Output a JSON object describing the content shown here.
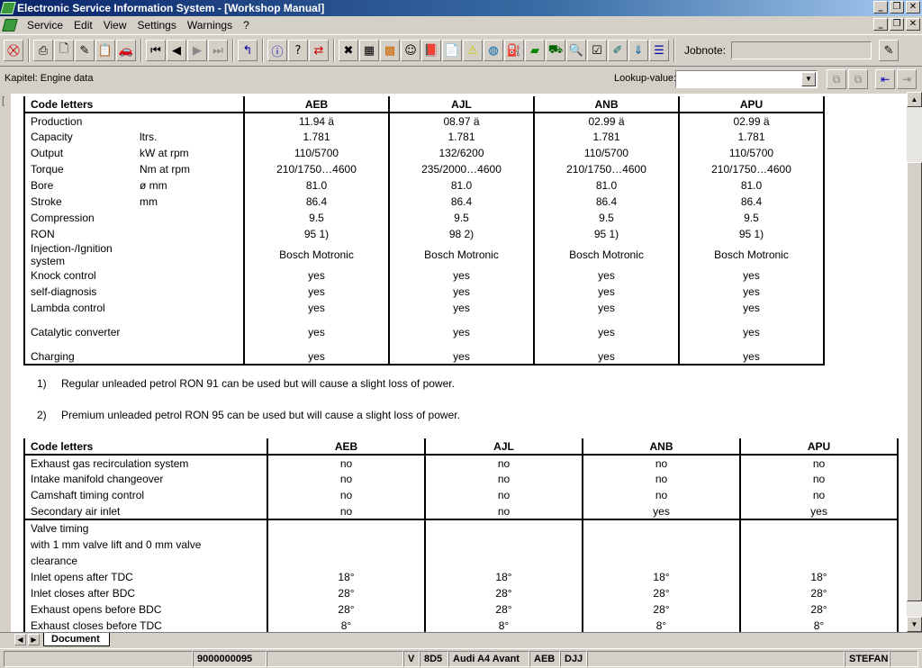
{
  "window": {
    "title": "Electronic Service Information System - [Workshop Manual]"
  },
  "menu": {
    "items": [
      "Service",
      "Edit",
      "View",
      "Settings",
      "Warnings",
      "?"
    ]
  },
  "toolbar": {
    "jobnote_label": "Jobnote:",
    "jobnote_value": ""
  },
  "chapterbar": {
    "chapter": "Kapitel: Engine data",
    "lookup_label": "Lookup-value:",
    "lookup_value": ""
  },
  "table1": {
    "headers": [
      "Code letters",
      "",
      "AEB",
      "AJL",
      "ANB",
      "APU"
    ],
    "rows": [
      [
        "Production",
        "",
        "11.94 ä",
        "08.97 ä",
        "02.99 ä",
        "02.99 ä"
      ],
      [
        "Capacity",
        "ltrs.",
        "1.781",
        "1.781",
        "1.781",
        "1.781"
      ],
      [
        "Output",
        "kW at rpm",
        "110/5700",
        "132/6200",
        "110/5700",
        "110/5700"
      ],
      [
        "Torque",
        "Nm at rpm",
        "210/1750…4600",
        "235/2000…4600",
        "210/1750…4600",
        "210/1750…4600"
      ],
      [
        "Bore",
        "ø mm",
        "81.0",
        "81.0",
        "81.0",
        "81.0"
      ],
      [
        "Stroke",
        "mm",
        "86.4",
        "86.4",
        "86.4",
        "86.4"
      ],
      [
        "Compression",
        "",
        "9.5",
        "9.5",
        "9.5",
        "9.5"
      ],
      [
        "RON",
        "",
        "95 1)",
        "98 2)",
        "95 1)",
        "95 1)"
      ],
      [
        "Injection-/Ignition system",
        "",
        "Bosch Motronic",
        "Bosch Motronic",
        "Bosch Motronic",
        "Bosch Motronic"
      ],
      [
        "Knock control",
        "",
        "yes",
        "yes",
        "yes",
        "yes"
      ],
      [
        "self-diagnosis",
        "",
        "yes",
        "yes",
        "yes",
        "yes"
      ],
      [
        "Lambda control",
        "",
        "yes",
        "yes",
        "yes",
        "yes"
      ],
      [
        "Catalytic converter",
        "",
        "yes",
        "yes",
        "yes",
        "yes"
      ],
      [
        "Charging",
        "",
        "yes",
        "yes",
        "yes",
        "yes"
      ]
    ]
  },
  "notes": [
    {
      "num": "1)",
      "text": "Regular unleaded petrol RON 91 can be used but will cause a slight loss of power."
    },
    {
      "num": "2)",
      "text": "Premium unleaded petrol RON 95 can be used but will cause a slight loss of power."
    }
  ],
  "table2": {
    "headers": [
      "Code letters",
      "AEB",
      "AJL",
      "ANB",
      "APU"
    ],
    "rows": [
      [
        "Exhaust gas recirculation system",
        "no",
        "no",
        "no",
        "no"
      ],
      [
        "Intake manifold changeover",
        "no",
        "no",
        "no",
        "no"
      ],
      [
        "Camshaft timing control",
        "no",
        "no",
        "no",
        "no"
      ],
      [
        "Secondary air inlet",
        "no",
        "no",
        "yes",
        "yes"
      ]
    ],
    "valve_heading": [
      "Valve timing",
      "with 1 mm valve lift and 0 mm valve",
      "clearance"
    ],
    "valve_rows": [
      [
        "Inlet opens after TDC",
        "18°",
        "18°",
        "18°",
        "18°"
      ],
      [
        "Inlet closes after BDC",
        "28°",
        "28°",
        "28°",
        "28°"
      ],
      [
        "Exhaust opens before BDC",
        "28°",
        "28°",
        "28°",
        "28°"
      ],
      [
        "Exhaust closes before TDC",
        "8°",
        "8°",
        "8°",
        "8°"
      ]
    ]
  },
  "tabs": {
    "document": "Document"
  },
  "status": {
    "number": "9000000095",
    "v": "V",
    "code": "8D5",
    "model": "Audi A4 Avant",
    "engine": "AEB",
    "gearbox": "DJJ",
    "user": "STEFAN"
  }
}
